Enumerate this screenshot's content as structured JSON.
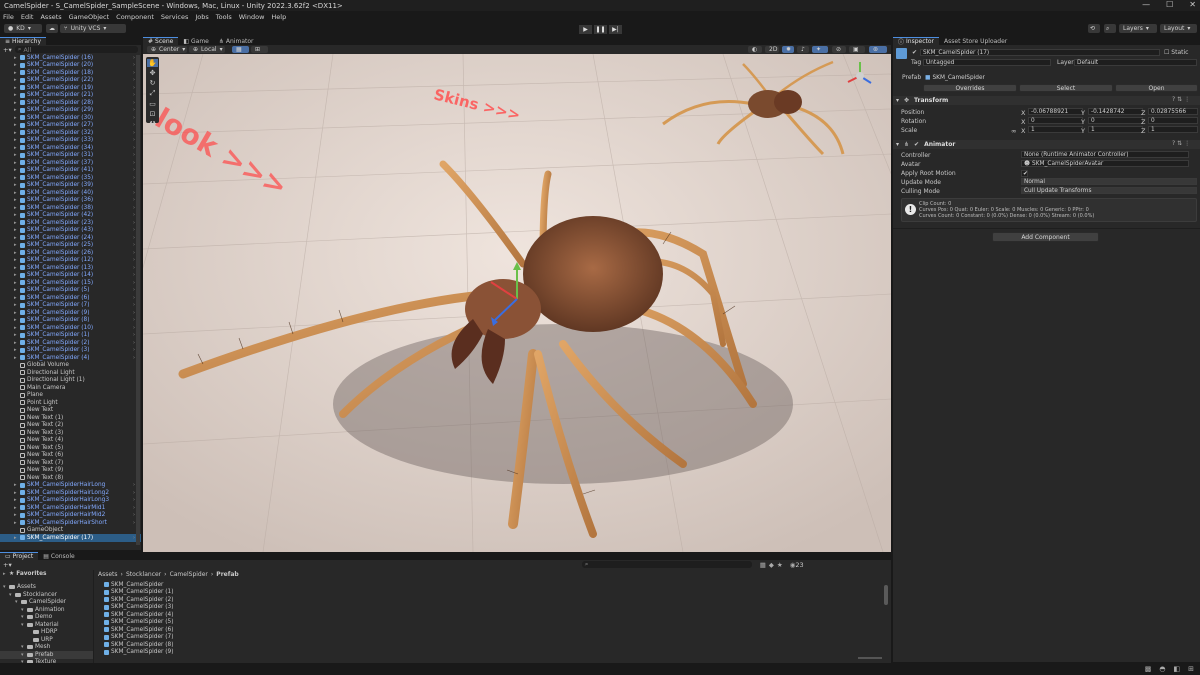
{
  "window": {
    "title": "CamelSpider - S_CamelSpider_SampleScene - Windows, Mac, Linux - Unity 2022.3.62f2 <DX11>",
    "minimize": "—",
    "maximize": "☐",
    "close": "✕"
  },
  "menu": [
    "File",
    "Edit",
    "Assets",
    "GameObject",
    "Component",
    "Services",
    "Jobs",
    "Tools",
    "Window",
    "Help"
  ],
  "toolbar": {
    "account": "KD",
    "vcs": "Unity VCS",
    "layers": "Layers",
    "layout": "Layout"
  },
  "hierarchy": {
    "tab": "Hierarchy",
    "search_placeholder": "All",
    "items": [
      {
        "name": "SKM_CamelSpider (16)",
        "prefab": true
      },
      {
        "name": "SKM_CamelSpider (20)",
        "prefab": true
      },
      {
        "name": "SKM_CamelSpider (18)",
        "prefab": true
      },
      {
        "name": "SKM_CamelSpider (22)",
        "prefab": true
      },
      {
        "name": "SKM_CamelSpider (19)",
        "prefab": true
      },
      {
        "name": "SKM_CamelSpider (21)",
        "prefab": true
      },
      {
        "name": "SKM_CamelSpider (28)",
        "prefab": true
      },
      {
        "name": "SKM_CamelSpider (29)",
        "prefab": true
      },
      {
        "name": "SKM_CamelSpider (30)",
        "prefab": true
      },
      {
        "name": "SKM_CamelSpider (27)",
        "prefab": true
      },
      {
        "name": "SKM_CamelSpider (32)",
        "prefab": true
      },
      {
        "name": "SKM_CamelSpider (33)",
        "prefab": true
      },
      {
        "name": "SKM_CamelSpider (34)",
        "prefab": true
      },
      {
        "name": "SKM_CamelSpider (31)",
        "prefab": true
      },
      {
        "name": "SKM_CamelSpider (37)",
        "prefab": true
      },
      {
        "name": "SKM_CamelSpider (41)",
        "prefab": true
      },
      {
        "name": "SKM_CamelSpider (35)",
        "prefab": true
      },
      {
        "name": "SKM_CamelSpider (39)",
        "prefab": true
      },
      {
        "name": "SKM_CamelSpider (40)",
        "prefab": true
      },
      {
        "name": "SKM_CamelSpider (36)",
        "prefab": true
      },
      {
        "name": "SKM_CamelSpider (38)",
        "prefab": true
      },
      {
        "name": "SKM_CamelSpider (42)",
        "prefab": true
      },
      {
        "name": "SKM_CamelSpider (23)",
        "prefab": true
      },
      {
        "name": "SKM_CamelSpider (43)",
        "prefab": true
      },
      {
        "name": "SKM_CamelSpider (24)",
        "prefab": true
      },
      {
        "name": "SKM_CamelSpider (25)",
        "prefab": true
      },
      {
        "name": "SKM_CamelSpider (26)",
        "prefab": true
      },
      {
        "name": "SKM_CamelSpider (12)",
        "prefab": true
      },
      {
        "name": "SKM_CamelSpider (13)",
        "prefab": true
      },
      {
        "name": "SKM_CamelSpider (14)",
        "prefab": true
      },
      {
        "name": "SKM_CamelSpider (15)",
        "prefab": true
      },
      {
        "name": "SKM_CamelSpider (5)",
        "prefab": true
      },
      {
        "name": "SKM_CamelSpider (6)",
        "prefab": true
      },
      {
        "name": "SKM_CamelSpider (7)",
        "prefab": true
      },
      {
        "name": "SKM_CamelSpider (9)",
        "prefab": true
      },
      {
        "name": "SKM_CamelSpider (8)",
        "prefab": true
      },
      {
        "name": "SKM_CamelSpider (10)",
        "prefab": true
      },
      {
        "name": "SKM_CamelSpider (1)",
        "prefab": true
      },
      {
        "name": "SKM_CamelSpider (2)",
        "prefab": true
      },
      {
        "name": "SKM_CamelSpider (3)",
        "prefab": true
      },
      {
        "name": "SKM_CamelSpider (4)",
        "prefab": true
      },
      {
        "name": "Global Volume",
        "prefab": false
      },
      {
        "name": "Directional Light",
        "prefab": false
      },
      {
        "name": "Directional Light (1)",
        "prefab": false
      },
      {
        "name": "Main Camera",
        "prefab": false
      },
      {
        "name": "Plane",
        "prefab": false
      },
      {
        "name": "Point Light",
        "prefab": false
      },
      {
        "name": "New Text",
        "prefab": false
      },
      {
        "name": "New Text (1)",
        "prefab": false
      },
      {
        "name": "New Text (2)",
        "prefab": false
      },
      {
        "name": "New Text (3)",
        "prefab": false
      },
      {
        "name": "New Text (4)",
        "prefab": false
      },
      {
        "name": "New Text (5)",
        "prefab": false
      },
      {
        "name": "New Text (6)",
        "prefab": false
      },
      {
        "name": "New Text (7)",
        "prefab": false
      },
      {
        "name": "New Text (9)",
        "prefab": false
      },
      {
        "name": "New Text (8)",
        "prefab": false
      },
      {
        "name": "SKM_CamelSpiderHairLong",
        "prefab": true
      },
      {
        "name": "SKM_CamelSpiderHairLong2",
        "prefab": true
      },
      {
        "name": "SKM_CamelSpiderHairLong3",
        "prefab": true
      },
      {
        "name": "SKM_CamelSpiderHairMid1",
        "prefab": true
      },
      {
        "name": "SKM_CamelSpiderHairMid2",
        "prefab": true
      },
      {
        "name": "SKM_CamelSpiderHairShort",
        "prefab": true
      },
      {
        "name": "GameObject",
        "prefab": false
      },
      {
        "name": "SKM_CamelSpider (17)",
        "prefab": true,
        "selected": true
      }
    ]
  },
  "scene": {
    "tabs": [
      "Scene",
      "Game",
      "Animator"
    ],
    "pivot": "Center",
    "space": "Local",
    "mode_2d": "2D",
    "floor_texts": [
      "Skins >>>",
      "look >>>"
    ]
  },
  "inspector": {
    "tabs": [
      "Inspector",
      "Asset Store Uploader"
    ],
    "object_name": "SKM_CamelSpider (17)",
    "static_label": "Static",
    "tag_label": "Tag",
    "tag_value": "Untagged",
    "layer_label": "Layer",
    "layer_value": "Default",
    "prefab_label": "Prefab",
    "prefab_value": "SKM_CamelSpider",
    "overrides": "Overrides",
    "select": "Select",
    "open": "Open",
    "transform": {
      "title": "Transform",
      "position_label": "Position",
      "rotation_label": "Rotation",
      "scale_label": "Scale",
      "position": {
        "x": "-0.06788921",
        "y": "-0.1428742",
        "z": "0.02875566"
      },
      "rotation": {
        "x": "0",
        "y": "0",
        "z": "0"
      },
      "scale": {
        "x": "1",
        "y": "1",
        "z": "1"
      }
    },
    "animator": {
      "title": "Animator",
      "controller_label": "Controller",
      "controller_value": "None (Runtime Animator Controller)",
      "avatar_label": "Avatar",
      "avatar_value": "SKM_CamelSpiderAvatar",
      "root_motion_label": "Apply Root Motion",
      "update_mode_label": "Update Mode",
      "update_mode_value": "Normal",
      "culling_label": "Culling Mode",
      "culling_value": "Cull Update Transforms",
      "info_line1": "Clip Count: 0",
      "info_line2": "Curves Pos: 0 Quat: 0 Euler: 0 Scale: 0 Muscles: 0 Generic: 0 PPtr: 0",
      "info_line3": "Curves Count: 0 Constant: 0 (0.0%) Dense: 0 (0.0%) Stream: 0 (0.0%)"
    },
    "add_component": "Add Component"
  },
  "project": {
    "tabs": [
      "Project",
      "Console"
    ],
    "favorites": "Favorites",
    "tree": [
      {
        "name": "Assets",
        "depth": 0
      },
      {
        "name": "Stocklancer",
        "depth": 1
      },
      {
        "name": "CamelSpider",
        "depth": 2
      },
      {
        "name": "Animation",
        "depth": 3
      },
      {
        "name": "Demo",
        "depth": 3
      },
      {
        "name": "Material",
        "depth": 3
      },
      {
        "name": "HDRP",
        "depth": 4
      },
      {
        "name": "URP",
        "depth": 4
      },
      {
        "name": "Mesh",
        "depth": 3
      },
      {
        "name": "Prefab",
        "depth": 3,
        "selected": true
      },
      {
        "name": "Texture",
        "depth": 3
      }
    ],
    "breadcrumb": [
      "Assets",
      "Stocklancer",
      "CamelSpider",
      "Prefab"
    ],
    "files": [
      "SKM_CamelSpider",
      "SKM_CamelSpider (1)",
      "SKM_CamelSpider (2)",
      "SKM_CamelSpider (3)",
      "SKM_CamelSpider (4)",
      "SKM_CamelSpider (5)",
      "SKM_CamelSpider (6)",
      "SKM_CamelSpider (7)",
      "SKM_CamelSpider (8)",
      "SKM_CamelSpider (9)"
    ],
    "hidden_count": "23"
  }
}
